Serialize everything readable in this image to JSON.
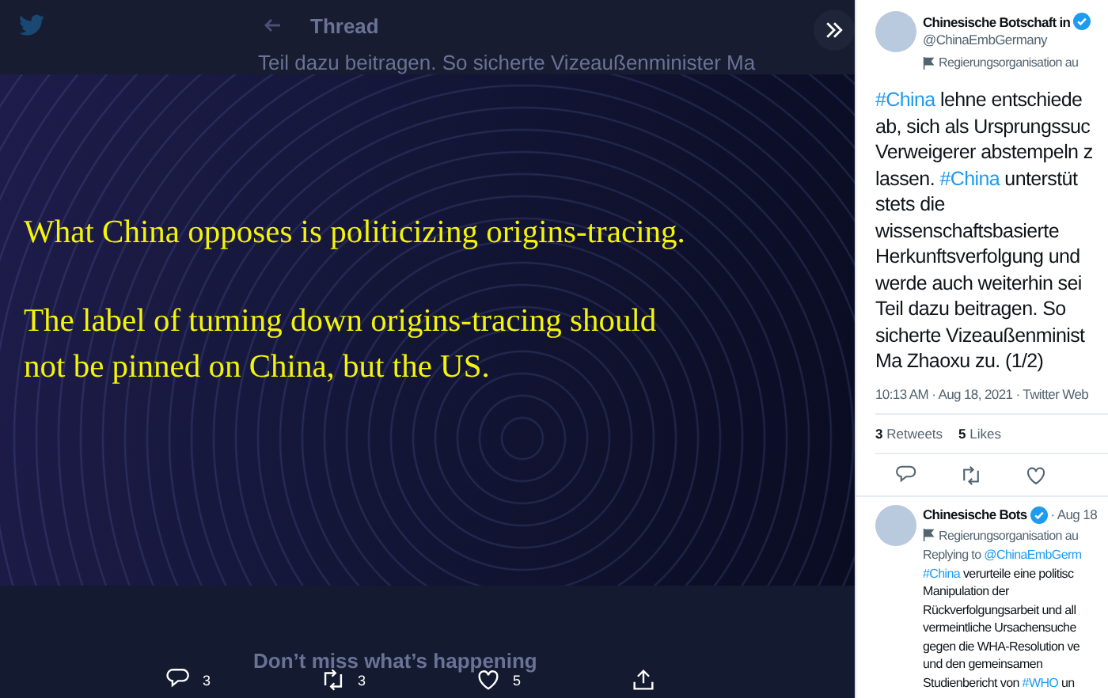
{
  "background": {
    "header_title": "Thread",
    "thread_line": "Teil dazu beitragen. So sicherte Vizeaußenminister Ma",
    "banner_title": "Don’t miss what’s happening"
  },
  "media": {
    "lines": [
      "What China opposes is politicizing origins-tracing.",
      "The label of turning down origins-tracing should",
      "not be pinned on China, but the US."
    ]
  },
  "media_actions": [
    {
      "kind": "reply",
      "count": "3"
    },
    {
      "kind": "retweet",
      "count": "3"
    },
    {
      "kind": "like",
      "count": "5"
    },
    {
      "kind": "share"
    }
  ],
  "tweet": {
    "author": "Chinesische Botschaft in",
    "verified": true,
    "handle": "@ChinaEmbGermany",
    "label": "Regierungsorganisation au",
    "lines": [
      [
        {
          "kind": "hashtag",
          "text": "#China"
        },
        {
          "kind": "plain",
          "text": " lehne entschiede"
        }
      ],
      [
        {
          "kind": "plain",
          "text": "ab, sich als Ursprungssuc"
        }
      ],
      [
        {
          "kind": "plain",
          "text": "Verweigerer abstempeln z"
        }
      ],
      [
        {
          "kind": "plain",
          "text": "lassen. "
        },
        {
          "kind": "hashtag",
          "text": "#China"
        },
        {
          "kind": "plain",
          "text": " unterstüt"
        }
      ],
      [
        {
          "kind": "plain",
          "text": "stets die"
        }
      ],
      [
        {
          "kind": "plain",
          "text": "wissenschaftsbasierte"
        }
      ],
      [
        {
          "kind": "plain",
          "text": "Herkunftsverfolgung und"
        }
      ],
      [
        {
          "kind": "plain",
          "text": "werde auch weiterhin sei"
        }
      ],
      [
        {
          "kind": "plain",
          "text": "Teil dazu beitragen. So"
        }
      ],
      [
        {
          "kind": "plain",
          "text": "sicherte Vizeaußenminist"
        }
      ],
      [
        {
          "kind": "plain",
          "text": "Ma Zhaoxu zu. (1/2)"
        }
      ]
    ],
    "meta": "10:13 AM · Aug 18, 2021 · Twitter Web",
    "stats": [
      "**3** Retweets",
      "**5** Likes"
    ],
    "actions": [
      {
        "kind": "reply"
      },
      {
        "kind": "retweet"
      },
      {
        "kind": "like"
      }
    ]
  },
  "reply_tweet": {
    "author": "Chinesische Bots",
    "verified": true,
    "date": "· Aug 18",
    "label": "Regierungsorganisation au",
    "replying_prefix": "Replying to ",
    "replying_handle": "@ChinaEmbGerm",
    "lines": [
      [
        {
          "kind": "hashtag",
          "text": "#China"
        },
        {
          "kind": "plain",
          "text": " verurteile eine politisc"
        }
      ],
      [
        {
          "kind": "plain",
          "text": "Manipulation der"
        }
      ],
      [
        {
          "kind": "plain",
          "text": "Rückverfolgungsarbeit und all"
        }
      ],
      [
        {
          "kind": "plain",
          "text": "vermeintliche Ursachensuche"
        }
      ],
      [
        {
          "kind": "plain",
          "text": "gegen die WHA-Resolution ve"
        }
      ],
      [
        {
          "kind": "plain",
          "text": "und den gemeinsamen"
        }
      ],
      [
        {
          "kind": "plain",
          "text": "Studienbericht von "
        },
        {
          "kind": "hashtag",
          "text": "#WHO"
        },
        {
          "kind": "plain",
          "text": " un"
        }
      ]
    ]
  }
}
